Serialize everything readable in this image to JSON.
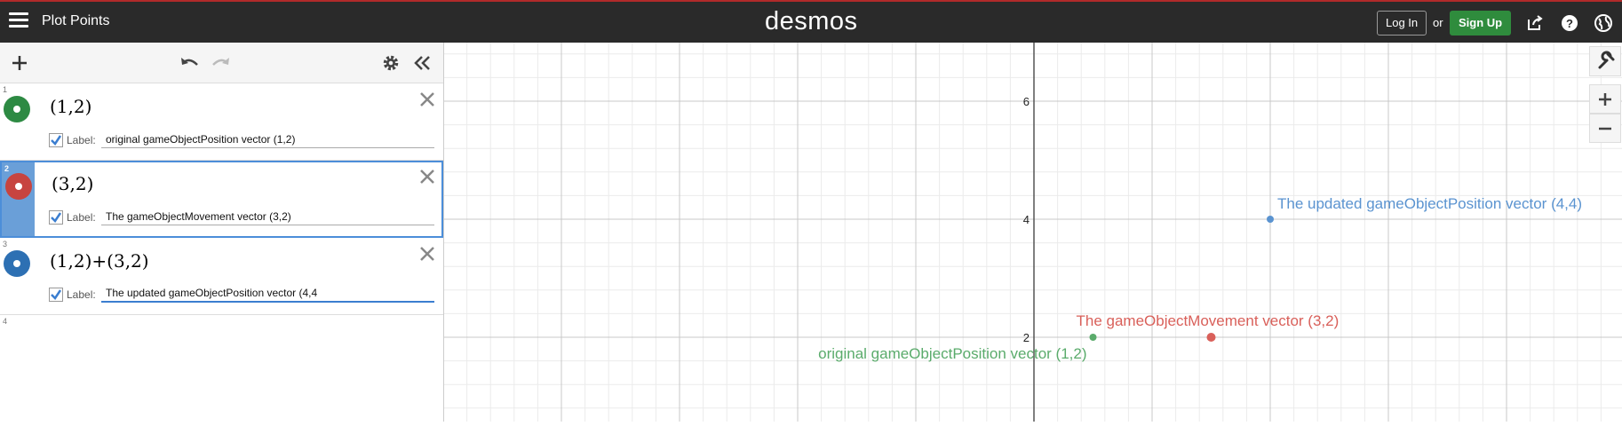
{
  "header": {
    "title": "Plot Points",
    "logo": "desmos",
    "login_label": "Log In",
    "or_text": "or",
    "signup_label": "Sign Up",
    "icons": [
      "share-icon",
      "help-icon",
      "globe-icon"
    ]
  },
  "toolbar": {
    "icons": [
      "add-icon",
      "undo-icon",
      "redo-icon",
      "settings-icon",
      "collapse-icon"
    ]
  },
  "expressions": [
    {
      "index": "1",
      "latex": "(1,2)",
      "color": "#2d8a43",
      "label_prompt": "Label:",
      "label_value": "original gameObjectPosition vector (1,2)",
      "label_checked": true
    },
    {
      "index": "2",
      "latex": "(3,2)",
      "color": "#c74440",
      "label_prompt": "Label:",
      "label_value": "The gameObjectMovement vector (3,2)",
      "label_checked": true
    },
    {
      "index": "3",
      "latex": "(1,2)+(3,2)",
      "color": "#2d70b3",
      "label_prompt": "Label:",
      "label_value": "The updated gameObjectPosition vector (4,4",
      "label_checked": true
    },
    {
      "index": "4"
    }
  ],
  "graph": {
    "y_ticks": [
      {
        "value": 6,
        "label": "6"
      },
      {
        "value": 4,
        "label": "4"
      },
      {
        "value": 2,
        "label": "2"
      }
    ],
    "points": [
      {
        "x": 1,
        "y": 2,
        "label": "original gameObjectPosition vector (1,2)",
        "color": "#5aab6b"
      },
      {
        "x": 3,
        "y": 2,
        "label": "The gameObjectMovement vector (3,2)",
        "color": "#d9605a"
      },
      {
        "x": 4,
        "y": 4,
        "label": "The updated gameObjectPosition vector (4,4)",
        "color": "#5a93d0"
      }
    ],
    "controls": [
      "wrench-icon",
      "zoom-in-icon",
      "zoom-out-icon"
    ]
  }
}
